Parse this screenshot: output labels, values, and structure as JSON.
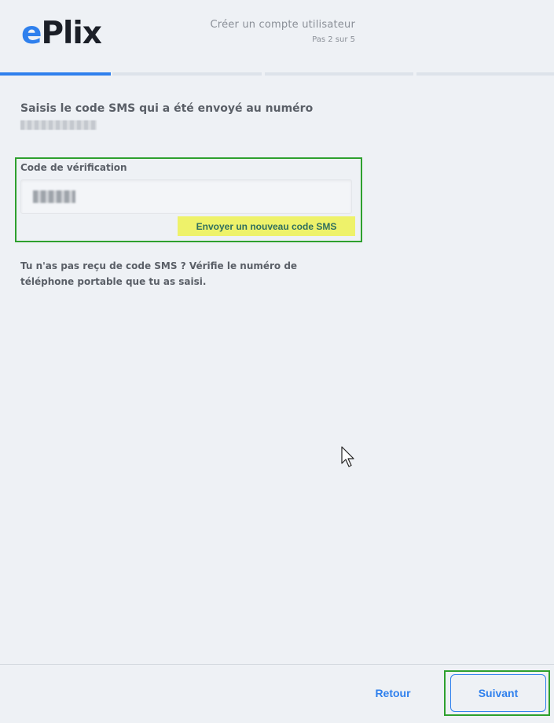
{
  "header": {
    "logo_e": "e",
    "logo_rest": "Plix",
    "title": "Créer un compte utilisateur",
    "step": "Pas 2 sur 5"
  },
  "progress": {
    "current_step": 2,
    "total_steps": 5
  },
  "main": {
    "prompt": "Saisis le code SMS qui a été envoyé au numéro",
    "verification_label": "Code de vérification",
    "resend_button": "Envoyer un nouveau code SMS",
    "help_text": "Tu n'as pas reçu de code SMS ? Vérifie le numéro de téléphone portable que tu as saisi."
  },
  "footer": {
    "back_button": "Retour",
    "next_button": "Suivant"
  },
  "colors": {
    "accent": "#2f80ed",
    "highlight": "#eef26a",
    "annotation": "#2ea02e",
    "background": "#eef1f5"
  },
  "icons": [
    "mouse-pointer-icon"
  ]
}
